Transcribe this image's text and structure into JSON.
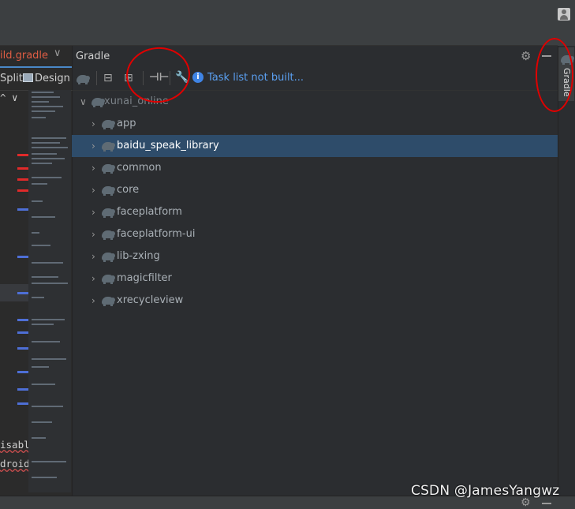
{
  "editor": {
    "tab_label": "ild.gradle",
    "view_split": "Split",
    "view_design": "Design",
    "code_lines": [
      {
        "text": "isabl",
        "underline": true
      },
      {
        "text": "droid",
        "underline": true
      }
    ]
  },
  "gradle_panel": {
    "title": "Gradle",
    "toolbar": {
      "icons": [
        "elephant-icon",
        "expand-all-icon",
        "collapse-all-icon",
        "toggle-offline-icon",
        "wrench-icon"
      ],
      "status_text": "Task list not built..."
    },
    "tree": {
      "root": "xunai_online",
      "modules": [
        "app",
        "baidu_speak_library",
        "common",
        "core",
        "faceplatform",
        "faceplatform-ui",
        "lib-zxing",
        "magicfilter",
        "xrecycleview"
      ],
      "selected": "baidu_speak_library"
    }
  },
  "right_stripe": {
    "tool_label": "Gradle"
  },
  "watermark": "CSDN @JamesYangwz",
  "colors": {
    "background": "#2b2d30",
    "selection": "#2e4c6a",
    "link": "#5a9ff0",
    "annotation": "#e00000"
  }
}
